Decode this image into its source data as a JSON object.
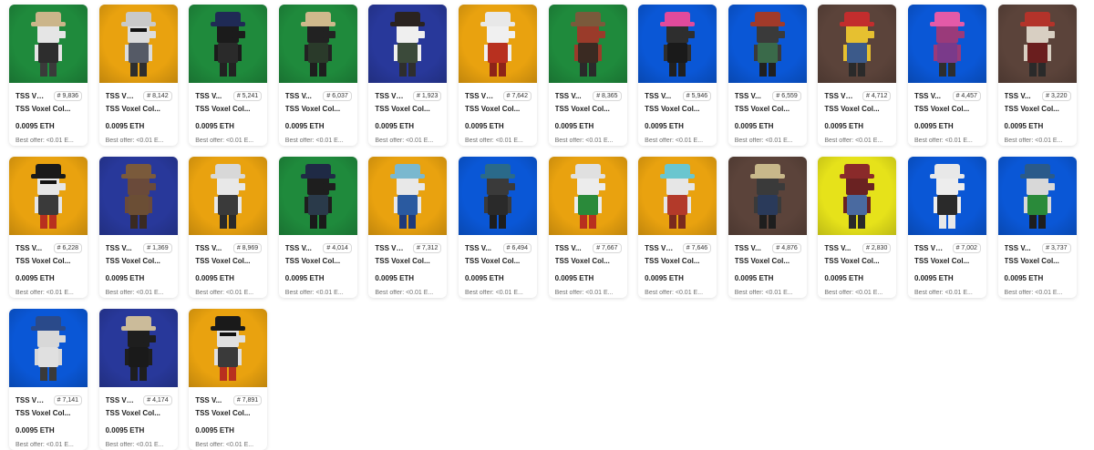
{
  "colors": {
    "green": "#1f8a3c",
    "orange": "#e9a20f",
    "royal": "#0a57d6",
    "navy": "#28389a",
    "brown": "#5b433a",
    "yellow": "#e6e21a"
  },
  "items": [
    {
      "short": "TSS VX...",
      "number": "# 9,836",
      "name": "TSS Voxel Col...",
      "price": "0.0095 ETH",
      "offer": "Best offer: <0.01 E...",
      "bg": "green",
      "hat": "#cbb58a",
      "head": "#e5e5e5",
      "body": "#2d2d2d",
      "legs": "#3a3a3a",
      "shades": false
    },
    {
      "short": "TSS VX...",
      "number": "# 8,142",
      "name": "TSS Voxel Col...",
      "price": "0.0095 ETH",
      "offer": "Best offer: <0.01 E...",
      "bg": "orange",
      "hat": "#c9c9c9",
      "head": "#dcdcdc",
      "body": "#555a66",
      "legs": "#2e2e2e",
      "shades": true
    },
    {
      "short": "TSS V...",
      "number": "# 5,241",
      "name": "TSS Voxel Col...",
      "price": "0.0095 ETH",
      "offer": "Best offer: <0.01 E...",
      "bg": "green",
      "hat": "#1f2a55",
      "head": "#1b1b1b",
      "body": "#2a2a2a",
      "legs": "#222",
      "shades": false
    },
    {
      "short": "TSS V...",
      "number": "# 6,037",
      "name": "TSS Voxel Col...",
      "price": "0.0095 ETH",
      "offer": "Best offer: <0.01 E...",
      "bg": "green",
      "hat": "#cfb98c",
      "head": "#222",
      "body": "#2a3a2a",
      "legs": "#1e1e1e",
      "shades": false
    },
    {
      "short": "TSS VX...",
      "number": "# 1,923",
      "name": "TSS Voxel Col...",
      "price": "0.0095 ETH",
      "offer": "Best offer: <0.01 E...",
      "bg": "navy",
      "hat": "#2a2320",
      "head": "#efefef",
      "body": "#3b4a3a",
      "legs": "#2e2e2e",
      "shades": false
    },
    {
      "short": "TSS VX...",
      "number": "# 7,642",
      "name": "TSS Voxel Col...",
      "price": "0.0095 ETH",
      "offer": "Best offer: <0.01 E...",
      "bg": "orange",
      "hat": "#e8e8e8",
      "head": "#f0f0f0",
      "body": "#b8301f",
      "legs": "#8e2418",
      "shades": false
    },
    {
      "short": "TSS V...",
      "number": "# 8,365",
      "name": "TSS Voxel Col...",
      "price": "0.0095 ETH",
      "offer": "Best offer: <0.01 E...",
      "bg": "green",
      "hat": "#7a5a3b",
      "head": "#9a3b2a",
      "body": "#3a2a22",
      "legs": "#2a2a2a",
      "shades": false
    },
    {
      "short": "TSS V...",
      "number": "# 5,946",
      "name": "TSS Voxel Col...",
      "price": "0.0095 ETH",
      "offer": "Best offer: <0.01 E...",
      "bg": "royal",
      "hat": "#e14a9c",
      "head": "#2e2e2e",
      "body": "#1a1a1a",
      "legs": "#202020",
      "shades": false
    },
    {
      "short": "TSS V...",
      "number": "# 6,559",
      "name": "TSS Voxel Col...",
      "price": "0.0095 ETH",
      "offer": "Best offer: <0.01 E...",
      "bg": "royal",
      "hat": "#a13a2a",
      "head": "#3a3a3a",
      "body": "#3a6a4a",
      "legs": "#202020",
      "shades": false
    },
    {
      "short": "TSS VX...",
      "number": "# 4,712",
      "name": "TSS Voxel Col...",
      "price": "0.0095 ETH",
      "offer": "Best offer: <0.01 E...",
      "bg": "brown",
      "hat": "#c22d2d",
      "head": "#e6c030",
      "body": "#3c5a8a",
      "legs": "#2a2a2a",
      "shades": false
    },
    {
      "short": "TSS V...",
      "number": "# 4,457",
      "name": "TSS Voxel Col...",
      "price": "0.0095 ETH",
      "offer": "Best offer: <0.01 E...",
      "bg": "royal",
      "hat": "#e45aa8",
      "head": "#9a3a7a",
      "body": "#7a3a8a",
      "legs": "#2e2e2e",
      "shades": false
    },
    {
      "short": "TSS V...",
      "number": "# 3,220",
      "name": "TSS Voxel Col...",
      "price": "0.0095 ETH",
      "offer": "Best offer: <0.01 E...",
      "bg": "brown",
      "hat": "#b3332a",
      "head": "#d8cfc2",
      "body": "#6a1e1e",
      "legs": "#2a2a2a",
      "shades": false
    },
    {
      "short": "TSS V...",
      "number": "# 6,228",
      "name": "TSS Voxel Col...",
      "price": "0.0095 ETH",
      "offer": "Best offer: <0.01 E...",
      "bg": "orange",
      "hat": "#1a1a1a",
      "head": "#e6e6e6",
      "body": "#3a3a3a",
      "legs": "#b8301f",
      "shades": true
    },
    {
      "short": "TSS V...",
      "number": "# 1,369",
      "name": "TSS Voxel Col...",
      "price": "0.0095 ETH",
      "offer": "Best offer: <0.01 E...",
      "bg": "navy",
      "hat": "#7a5a3b",
      "head": "#6a4a3a",
      "body": "#6b4e35",
      "legs": "#3a2a22",
      "shades": false
    },
    {
      "short": "TSS V...",
      "number": "# 8,969",
      "name": "TSS Voxel Col...",
      "price": "0.0095 ETH",
      "offer": "Best offer: <0.01 E...",
      "bg": "orange",
      "hat": "#d8d8d8",
      "head": "#e8e8e8",
      "body": "#3a3a3a",
      "legs": "#2a2a2a",
      "shades": false
    },
    {
      "short": "TSS V...",
      "number": "# 4,014",
      "name": "TSS Voxel Col...",
      "price": "0.0095 ETH",
      "offer": "Best offer: <0.01 E...",
      "bg": "green",
      "hat": "#1f2a45",
      "head": "#1e1e1e",
      "body": "#2a3a4a",
      "legs": "#1a1a1a",
      "shades": false
    },
    {
      "short": "TSS VX...",
      "number": "# 7,312",
      "name": "TSS Voxel Col...",
      "price": "0.0095 ETH",
      "offer": "Best offer: <0.01 E...",
      "bg": "orange",
      "hat": "#7ab8cf",
      "head": "#e8e8e8",
      "body": "#2a5aa0",
      "legs": "#1e3a7a",
      "shades": false
    },
    {
      "short": "TSS V...",
      "number": "# 6,494",
      "name": "TSS Voxel Col...",
      "price": "0.0095 ETH",
      "offer": "Best offer: <0.01 E...",
      "bg": "royal",
      "hat": "#2a6a8a",
      "head": "#3a3a3a",
      "body": "#2a2a2a",
      "legs": "#1e1e1e",
      "shades": false
    },
    {
      "short": "TSS V...",
      "number": "# 7,667",
      "name": "TSS Voxel Col...",
      "price": "0.0095 ETH",
      "offer": "Best offer: <0.01 E...",
      "bg": "orange",
      "hat": "#e0e0e0",
      "head": "#ececec",
      "body": "#2a8a3a",
      "legs": "#b8301f",
      "shades": false
    },
    {
      "short": "TSS VX...",
      "number": "# 7,646",
      "name": "TSS Voxel Col...",
      "price": "0.0095 ETH",
      "offer": "Best offer: <0.01 E...",
      "bg": "orange",
      "hat": "#6ac6cf",
      "head": "#e6e6e6",
      "body": "#b33a2a",
      "legs": "#7a2a1e",
      "shades": false
    },
    {
      "short": "TSS V...",
      "number": "# 4,876",
      "name": "TSS Voxel Col...",
      "price": "0.0095 ETH",
      "offer": "Best offer: <0.01 E...",
      "bg": "brown",
      "hat": "#c8b88a",
      "head": "#3a3a3a",
      "body": "#2a3a5a",
      "legs": "#1e1e1e",
      "shades": false
    },
    {
      "short": "TSS V...",
      "number": "# 2,830",
      "name": "TSS Voxel Col...",
      "price": "0.0095 ETH",
      "offer": "Best offer: <0.01 E...",
      "bg": "yellow",
      "hat": "#8a2a2a",
      "head": "#6a2222",
      "body": "#4a6aa0",
      "legs": "#2a2a2a",
      "shades": false
    },
    {
      "short": "TSS VX...",
      "number": "# 7,002",
      "name": "TSS Voxel Col...",
      "price": "0.0095 ETH",
      "offer": "Best offer: <0.01 E...",
      "bg": "royal",
      "hat": "#e8e8e8",
      "head": "#ededed",
      "body": "#2a2a2a",
      "legs": "#e8e8e8",
      "shades": false
    },
    {
      "short": "TSS V...",
      "number": "# 3,737",
      "name": "TSS Voxel Col...",
      "price": "0.0095 ETH",
      "offer": "Best offer: <0.01 E...",
      "bg": "royal",
      "hat": "#2a5a8a",
      "head": "#d8d8d8",
      "body": "#2a8a3a",
      "legs": "#1e1e1e",
      "shades": false
    },
    {
      "short": "TSS VX...",
      "number": "# 7,141",
      "name": "TSS Voxel Col...",
      "price": "0.0095 ETH",
      "offer": "Best offer: <0.01 E...",
      "bg": "royal",
      "hat": "#2a4a8a",
      "head": "#d8d8d8",
      "body": "#e0e0e0",
      "legs": "#3a3a3a",
      "shades": false
    },
    {
      "short": "TSS VX...",
      "number": "# 4,174",
      "name": "TSS Voxel Col...",
      "price": "0.0095 ETH",
      "offer": "Best offer: <0.01 E...",
      "bg": "navy",
      "hat": "#cbbb9a",
      "head": "#1e1e1e",
      "body": "#1a1a1a",
      "legs": "#1e1e1e",
      "shades": false
    },
    {
      "short": "TSS V...",
      "number": "# 7,891",
      "name": "TSS Voxel Col...",
      "price": "0.0095 ETH",
      "offer": "Best offer: <0.01 E...",
      "bg": "orange",
      "hat": "#1a1a1a",
      "head": "#e0e0e0",
      "body": "#3a3a3a",
      "legs": "#b8301f",
      "shades": true
    }
  ]
}
